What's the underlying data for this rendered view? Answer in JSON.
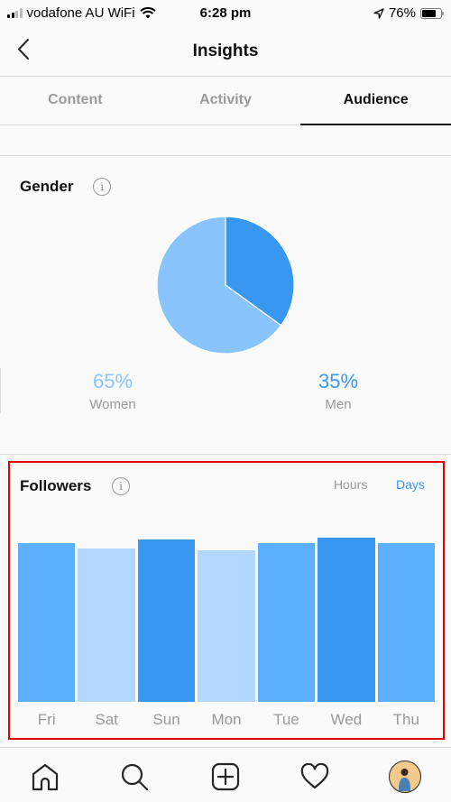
{
  "status_bar": {
    "carrier": "vodafone AU WiFi",
    "time": "6:28 pm",
    "battery": "76%",
    "battery_level": 0.76,
    "signal_bars": 2,
    "signal_total": 4
  },
  "header": {
    "title": "Insights",
    "back_icon": "chevron-left-icon"
  },
  "tabs": [
    {
      "label": "Content",
      "active": false
    },
    {
      "label": "Activity",
      "active": false
    },
    {
      "label": "Audience",
      "active": true
    }
  ],
  "gender": {
    "title": "Gender",
    "info_icon": "info-icon",
    "women": {
      "value": "65%",
      "label": "Women",
      "color": "#8ac4fc"
    },
    "men": {
      "value": "35%",
      "label": "Men",
      "color": "#3897f0"
    }
  },
  "followers": {
    "title": "Followers",
    "info_icon": "info-icon",
    "toggles": [
      {
        "label": "Hours",
        "active": false
      },
      {
        "label": "Days",
        "active": true
      }
    ]
  },
  "chart_data": [
    {
      "type": "pie",
      "title": "Gender",
      "categories": [
        "Women",
        "Men"
      ],
      "values": [
        65,
        35
      ],
      "colors": [
        "#8ac4fc",
        "#3897f0"
      ]
    },
    {
      "type": "bar",
      "title": "Followers",
      "categories": [
        "Fri",
        "Sat",
        "Sun",
        "Mon",
        "Tue",
        "Wed",
        "Thu"
      ],
      "values": [
        88,
        85,
        90,
        84,
        88,
        91,
        88
      ],
      "value_unit": "relative (no axis shown)",
      "colors": [
        "#5cafff",
        "#b3d8fd",
        "#3897f0",
        "#b3d8fd",
        "#5cafff",
        "#3897f0",
        "#5cafff"
      ],
      "ylim": [
        0,
        100
      ],
      "xlabel": "",
      "ylabel": "",
      "grid": false
    }
  ],
  "bottom_nav": [
    {
      "icon": "home-icon"
    },
    {
      "icon": "search-icon"
    },
    {
      "icon": "add-post-icon"
    },
    {
      "icon": "heart-icon"
    },
    {
      "icon": "profile-avatar"
    }
  ]
}
